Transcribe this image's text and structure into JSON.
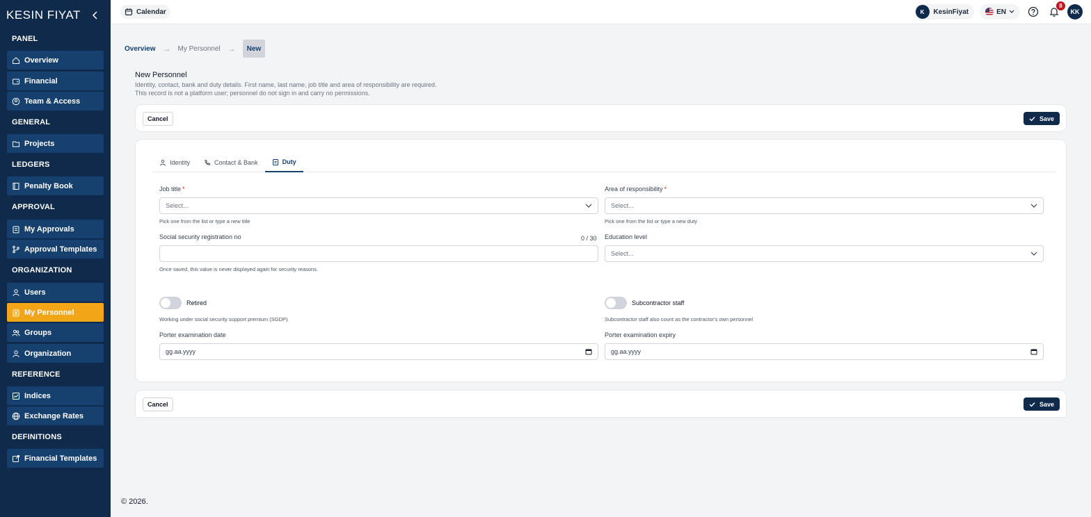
{
  "brand": {
    "logo_text": "KESIN FIYAT"
  },
  "sidebar": {
    "sections": [
      {
        "title": "PANEL",
        "items": [
          {
            "label": "Overview",
            "icon": "home-icon"
          },
          {
            "label": "Financial",
            "icon": "wallet-icon"
          },
          {
            "label": "Team & Access",
            "icon": "user-circle-icon"
          }
        ]
      },
      {
        "title": "GENERAL",
        "items": [
          {
            "label": "Projects",
            "icon": "folder-icon"
          }
        ]
      },
      {
        "title": "LEDGERS",
        "items": [
          {
            "label": "Penalty Book",
            "icon": "book-icon"
          }
        ]
      },
      {
        "title": "APPROVAL",
        "items": [
          {
            "label": "My Approvals",
            "icon": "clipboard-icon"
          },
          {
            "label": "Approval Templates",
            "icon": "branch-icon"
          }
        ]
      },
      {
        "title": "ORGANIZATION",
        "items": [
          {
            "label": "Users",
            "icon": "user-icon"
          },
          {
            "label": "My Personnel",
            "icon": "clipboard-user-icon",
            "active": true
          },
          {
            "label": "Groups",
            "icon": "users-icon"
          },
          {
            "label": "Organization",
            "icon": "org-icon"
          }
        ]
      },
      {
        "title": "REFERENCE",
        "items": [
          {
            "label": "Indices",
            "icon": "chart-icon"
          },
          {
            "label": "Exchange Rates",
            "icon": "globe-icon"
          }
        ]
      },
      {
        "title": "DEFINITIONS",
        "items": [
          {
            "label": "Financial Templates",
            "icon": "external-doc-icon"
          }
        ]
      }
    ]
  },
  "topbar": {
    "calendar_label": "Calendar",
    "user_initial": "K",
    "user_name": "KesinFiyat",
    "lang": "EN",
    "notif_count": "8",
    "avatar_initials": "KK"
  },
  "breadcrumb": {
    "items": [
      "Overview",
      "My Personnel",
      "New"
    ]
  },
  "page": {
    "title": "New Personnel",
    "desc_line1": "Identity, contact, bank and duty details. First name, last name, job title and area of responsibility are required.",
    "desc_line2": "This record is not a platform user; personnel do not sign in and carry no permissions."
  },
  "actions": {
    "cancel": "Cancel",
    "save": "Save"
  },
  "tabs": [
    {
      "label": "Identity",
      "icon": "user-icon"
    },
    {
      "label": "Contact & Bank",
      "icon": "phone-icon"
    },
    {
      "label": "Duty",
      "icon": "clipboard-icon",
      "active": true
    }
  ],
  "form": {
    "job_title": {
      "label": "Job title",
      "placeholder": "Select...",
      "hint": "Pick one from the list or type a new title"
    },
    "area": {
      "label": "Area of responsibility",
      "placeholder": "Select...",
      "hint": "Pick one from the list or type a new duty"
    },
    "ssn": {
      "label": "Social security registration no",
      "counter": "0 / 30",
      "value": "",
      "hint": "Once saved, this value is never displayed again for security reasons."
    },
    "education": {
      "label": "Education level",
      "placeholder": "Select..."
    },
    "retired": {
      "label": "Retired",
      "checked": false,
      "hint": "Working under social security support premium (SGDP)"
    },
    "subcontractor": {
      "label": "Subcontractor staff",
      "checked": false,
      "hint": "Subcontractor staff also count as the contractor's own personnel"
    },
    "porter_date": {
      "label": "Porter examination date",
      "value": "gg.aa.yyyy"
    },
    "porter_expiry": {
      "label": "Porter examination expiry",
      "value": "gg.aa.yyyy"
    }
  },
  "footer": {
    "text": "© 2026."
  }
}
